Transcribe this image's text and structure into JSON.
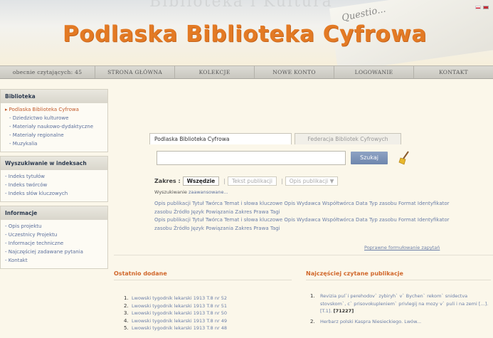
{
  "header": {
    "top_text": "Biblioteka i Kultura",
    "paper_text": "Questio...",
    "site_title": "Podlaska Biblioteka Cyfrowa"
  },
  "navbar": {
    "items": [
      {
        "label": "obecnie czytających: 45"
      },
      {
        "label": "STRONA GŁÓWNA"
      },
      {
        "label": "KOLEKCJE"
      },
      {
        "label": "NOWE KONTO"
      },
      {
        "label": "LOGOWANIE"
      },
      {
        "label": "KONTAKT"
      }
    ]
  },
  "sidebar": {
    "biblioteka": {
      "heading": "Biblioteka",
      "items": [
        {
          "label": "Podlaska Biblioteka Cyfrowa"
        },
        {
          "label": "Dziedzictwo kulturowe"
        },
        {
          "label": "Materiały naukowo-dydaktyczne"
        },
        {
          "label": "Materiały regionalne"
        },
        {
          "label": "Muzykalia"
        }
      ]
    },
    "indeksy": {
      "heading": "Wyszukiwanie w indeksach",
      "items": [
        {
          "label": "Indeks tytułów"
        },
        {
          "label": "Indeks twórców"
        },
        {
          "label": "Indeks słów kluczowych"
        }
      ]
    },
    "informacje": {
      "heading": "Informacje",
      "items": [
        {
          "label": "Opis projektu"
        },
        {
          "label": "Uczestnicy Projektu"
        },
        {
          "label": "Informacje techniczne"
        },
        {
          "label": "Najczęściej zadawane pytania"
        },
        {
          "label": "Kontakt"
        }
      ]
    }
  },
  "search": {
    "tab_active": "Podlaska Biblioteka Cyfrowa",
    "tab_inactive": "Federacja Bibliotek Cyfrowych",
    "input_value": "",
    "button_label": "Szukaj",
    "scope_label": "Zakres :",
    "scope_options": [
      "Wszędzie",
      "Tekst publikacji",
      "Opis publikacji ▼"
    ],
    "scope_sep": "|",
    "advanced_prefix": "Wyszukiwanie ",
    "advanced_link": "zaawansowane...",
    "field_lines": [
      "Opis publikacji Tytuł Twórca Temat i słowa kluczowe Opis Wydawca Współtwórca Data Typ zasobu Format Identyfikator zasobu Źródło Język Powiązania Zakres Prawa Tagi",
      "Opis publikacji Tytuł Twórca Temat i słowa kluczowe Opis Wydawca Współtwórca Data Typ zasobu Format Identyfikator zasobu Źródło Język Powiązania Zakres Prawa Tagi"
    ],
    "format_link": "Poprawne formułowanie zapytań"
  },
  "latest": {
    "heading": "Ostatnio dodane",
    "items": [
      {
        "num": "1.",
        "text": "Lwowski tygodnik lekarski 1913 T.8 nr 52"
      },
      {
        "num": "2.",
        "text": "Lwowski tygodnik lekarski 1913 T.8 nr 51"
      },
      {
        "num": "3.",
        "text": "Lwowski tygodnik lekarski 1913 T.8 nr 50"
      },
      {
        "num": "4.",
        "text": "Lwowski tygodnik lekarski 1913 T.8 nr 49"
      },
      {
        "num": "5.",
        "text": "Lwowski tygodnik lekarski 1913 T.8 nr 48"
      }
    ]
  },
  "popular": {
    "heading": "Najczęściej czytane publikacje",
    "items": [
      {
        "num": "1.",
        "text": "Revizia pul`i perehodov` zybiryh` v` Bychen` rekom` snidectva stovskom`, c` prisovokupleniem` privlegij na mozy v` puli i na zemi [...]. [T.1].",
        "rank": "[71227]"
      },
      {
        "num": "2.",
        "text": "Herbarz polski Kaspra Niesieckiego. Lwów..."
      }
    ]
  }
}
